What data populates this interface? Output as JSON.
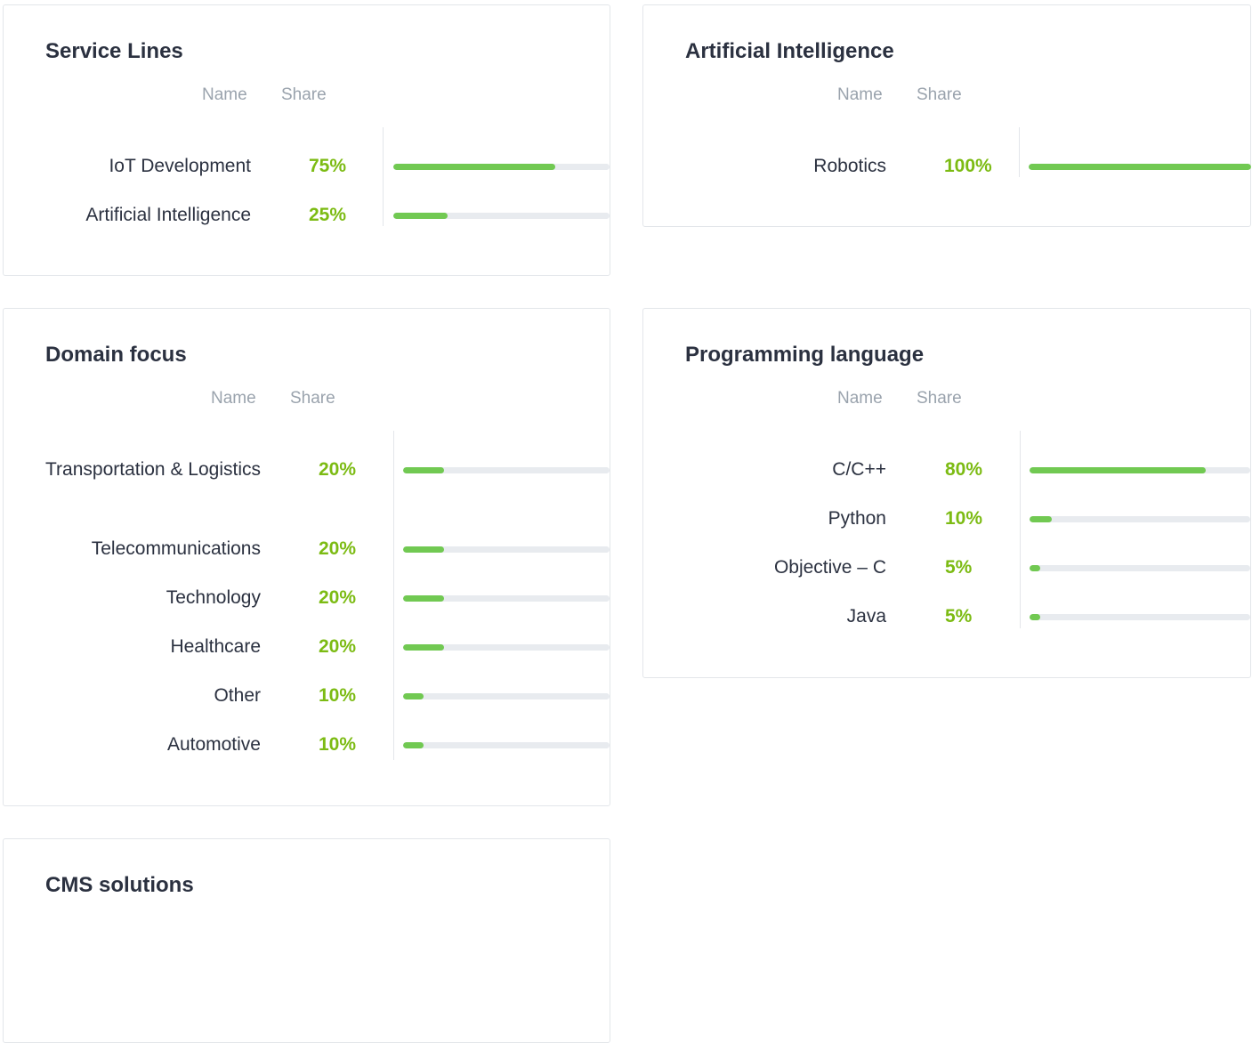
{
  "cards": {
    "service_lines": {
      "title": "Service Lines",
      "header": {
        "name": "Name",
        "share": "Share"
      },
      "rows": [
        {
          "name": "IoT Development",
          "pct_label": "75%",
          "value": 75
        },
        {
          "name": "Artificial Intelligence",
          "pct_label": "25%",
          "value": 25
        }
      ]
    },
    "artificial_intelligence": {
      "title": "Artificial Intelligence",
      "header": {
        "name": "Name",
        "share": "Share"
      },
      "rows": [
        {
          "name": "Robotics",
          "pct_label": "100%",
          "value": 100
        }
      ]
    },
    "domain_focus": {
      "title": "Domain focus",
      "header": {
        "name": "Name",
        "share": "Share"
      },
      "rows": [
        {
          "name": "Transportation & Logistics",
          "pct_label": "20%",
          "value": 20
        },
        {
          "name": "Telecommunications",
          "pct_label": "20%",
          "value": 20
        },
        {
          "name": "Technology",
          "pct_label": "20%",
          "value": 20
        },
        {
          "name": "Healthcare",
          "pct_label": "20%",
          "value": 20
        },
        {
          "name": "Other",
          "pct_label": "10%",
          "value": 10
        },
        {
          "name": "Automotive",
          "pct_label": "10%",
          "value": 10
        }
      ]
    },
    "programming_language": {
      "title": "Programming language",
      "header": {
        "name": "Name",
        "share": "Share"
      },
      "rows": [
        {
          "name": "C/C++",
          "pct_label": "80%",
          "value": 80
        },
        {
          "name": "Python",
          "pct_label": "10%",
          "value": 10
        },
        {
          "name": "Objective – C",
          "pct_label": "5%",
          "value": 5
        },
        {
          "name": "Java",
          "pct_label": "5%",
          "value": 5
        }
      ]
    },
    "cms_solutions": {
      "title": "CMS solutions"
    }
  },
  "colors": {
    "bar_fill": "#71c952",
    "bar_track": "#e8ebef",
    "percent_text": "#7cbb13"
  }
}
